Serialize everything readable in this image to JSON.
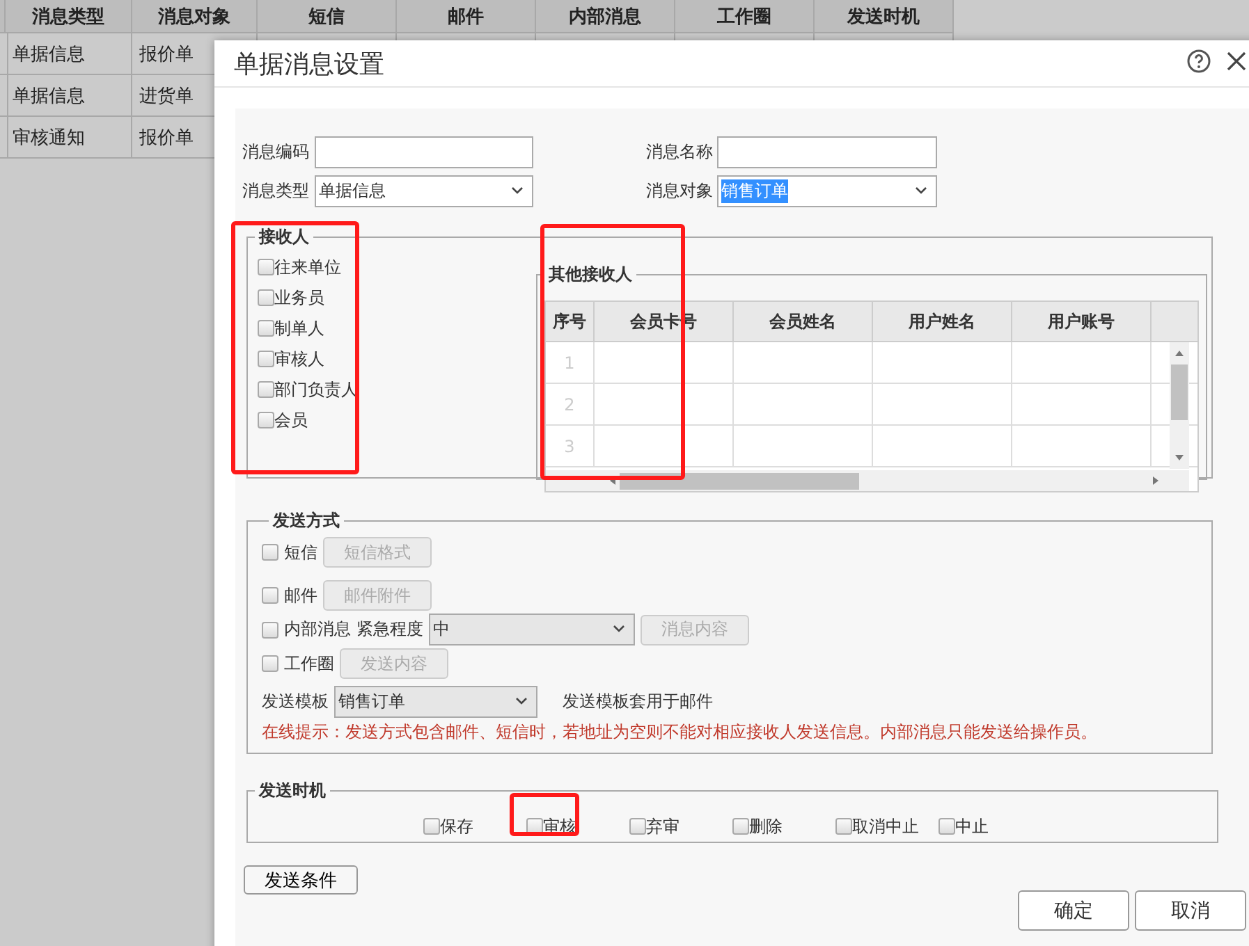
{
  "background_table": {
    "columns": [
      "消息类型",
      "消息对象",
      "短信",
      "邮件",
      "内部消息",
      "工作圈",
      "发送时机"
    ],
    "rows": [
      [
        "单据信息",
        "报价单"
      ],
      [
        "单据信息",
        "进货单"
      ],
      [
        "审核通知",
        "报价单"
      ]
    ]
  },
  "dialog": {
    "title": "单据消息设置",
    "fields": [
      {
        "label": "消息编码",
        "kind": "input"
      },
      {
        "label": "消息名称",
        "kind": "input"
      },
      {
        "label": "消息类型",
        "kind": "select",
        "value": "单据信息",
        "highlighted": false
      },
      {
        "label": "消息对象",
        "kind": "select",
        "value": "销售订单",
        "highlighted": true
      }
    ],
    "recipients": {
      "legend": "接收人",
      "options": [
        {
          "label": "往来单位",
          "checked": false
        },
        {
          "label": "业务员",
          "checked": false
        },
        {
          "label": "制单人",
          "checked": false
        },
        {
          "label": "审核人",
          "checked": false
        },
        {
          "label": "部门负责人",
          "checked": false
        },
        {
          "label": "会员",
          "checked": false
        }
      ]
    },
    "other_recipients": {
      "legend": "其他接收人",
      "columns": [
        "序号",
        "会员卡号",
        "会员姓名",
        "用户姓名",
        "用户账号"
      ],
      "rows": [
        "1",
        "2",
        "3"
      ]
    },
    "send_methods": {
      "legend": "发送方式",
      "items": [
        {
          "kind": "plain",
          "label": "短信",
          "checked": false,
          "button": {
            "label": "短信格式",
            "disabled": true
          }
        },
        {
          "kind": "plain",
          "label": "邮件",
          "checked": false,
          "button": {
            "label": "邮件附件",
            "disabled": true
          }
        },
        {
          "kind": "urgency",
          "label": "内部消息",
          "checked": false,
          "urgency_label": "紧急程度",
          "urgency_value": "中",
          "button": {
            "label": "消息内容",
            "disabled": true
          }
        },
        {
          "kind": "plain",
          "label": "工作圈",
          "checked": false,
          "button": {
            "label": "发送内容",
            "disabled": true
          }
        }
      ],
      "template": {
        "label": "发送模板",
        "value": "销售订单",
        "note": "发送模板套用于邮件"
      },
      "tip": "在线提示：发送方式包含邮件、短信时，若地址为空则不能对相应接收人发送信息。内部消息只能发送给操作员。"
    },
    "send_timing": {
      "legend": "发送时机",
      "options": [
        {
          "label": "保存",
          "checked": false
        },
        {
          "label": "审核",
          "checked": false
        },
        {
          "label": "弃审",
          "checked": false
        },
        {
          "label": "删除",
          "checked": false
        },
        {
          "label": "取消中止",
          "checked": false
        },
        {
          "label": "中止",
          "checked": false
        }
      ]
    },
    "condition_button": "发送条件",
    "buttons": [
      "确定",
      "取消"
    ]
  }
}
